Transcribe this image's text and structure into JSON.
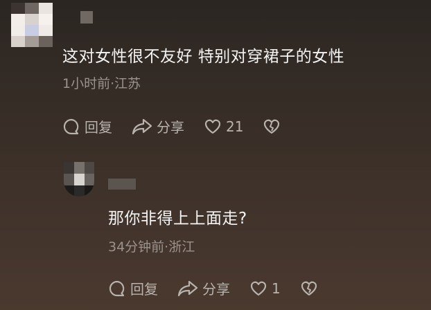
{
  "comments": [
    {
      "text": "这对女性很不友好 特别对穿裙子的女性",
      "meta": "1小时前·江苏",
      "reply_label": "回复",
      "share_label": "分享",
      "like_count": "21"
    },
    {
      "text": "那你非得上上面走?",
      "meta": "34分钟前·浙江",
      "reply_label": "回复",
      "share_label": "分享",
      "like_count": "1"
    }
  ],
  "colors": {
    "text": "#f4f4f4",
    "meta": "#9b938d",
    "icon": "#b9b3ae"
  },
  "icons": [
    "comment-bubble-icon",
    "share-arrow-icon",
    "heart-icon",
    "broken-heart-icon"
  ]
}
